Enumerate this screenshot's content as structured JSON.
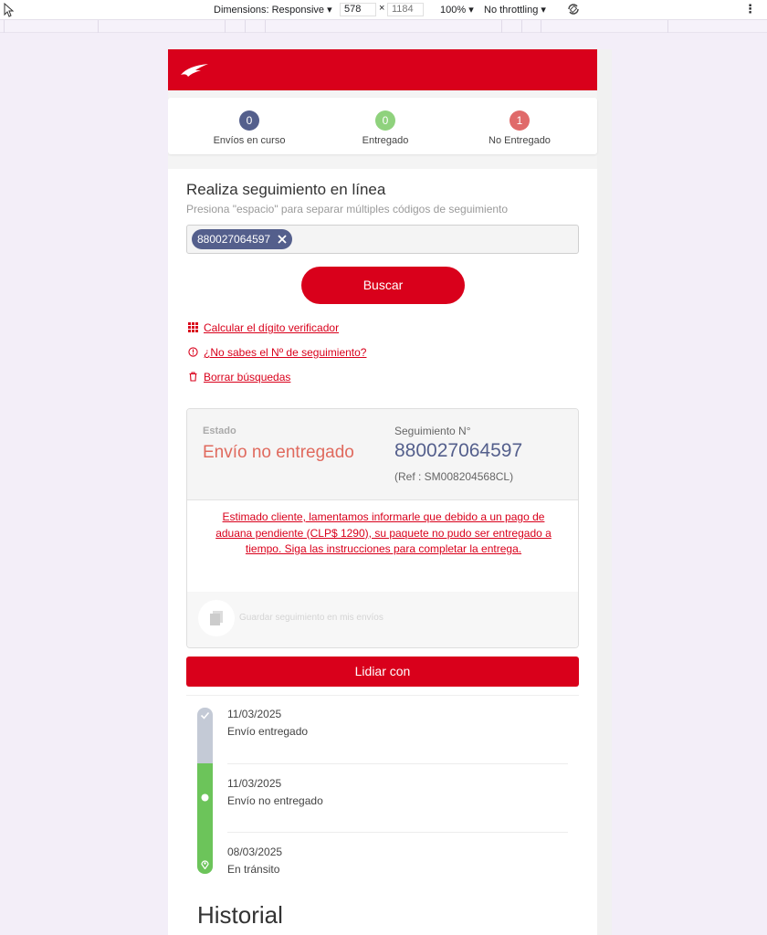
{
  "devtools": {
    "dimensions_label": "Dimensions: Responsive ▾",
    "width": "578",
    "times": "×",
    "height": "1184",
    "zoom": "100% ▾",
    "throttling": "No throttling ▾",
    "kebab": "⋮"
  },
  "counters": [
    {
      "count": "0",
      "label": "Envíos en curso",
      "color": "#545f8c"
    },
    {
      "count": "0",
      "label": "Entregado",
      "color": "#8fd27d"
    },
    {
      "count": "1",
      "label": "No Entregado",
      "color": "#e06a6a"
    }
  ],
  "search": {
    "title": "Realiza seguimiento en línea",
    "subtitle": "Presiona \"espacio\" para separar múltiples códigos de seguimiento",
    "chip": "880027064597",
    "button": "Buscar"
  },
  "links": {
    "calc": "Calcular el dígito verificador",
    "unknown": "¿No sabes el Nº de seguimiento?",
    "clear": "Borrar búsquedas"
  },
  "result": {
    "estado_label": "Estado",
    "estado_value": "Envío no entregado",
    "seg_label": "Seguimiento N°",
    "seg_value": "880027064597",
    "seg_ref": "(Ref : SM008204568CL)",
    "message": "Estimado cliente, lamentamos informarle que debido a un pago de aduana pendiente (CLP$ 1290), su paquete no pudo ser entregado a tiempo. Siga las instrucciones para completar la entrega.",
    "save_label": "Guardar seguimiento en mis envíos"
  },
  "action_button": "Lidiar con",
  "timeline": [
    {
      "date": "11/03/2025",
      "status": "Envío entregado",
      "icon": "check-icon"
    },
    {
      "date": "11/03/2025",
      "status": "Envío no entregado",
      "icon": "dot-icon"
    },
    {
      "date": "08/03/2025",
      "status": "En tránsito",
      "icon": "location-pin-icon"
    }
  ],
  "historial_title": "Historial",
  "colors": {
    "brand_red": "#d9001b",
    "navy": "#545f8c",
    "green": "#6cc45a",
    "status_red": "#e06a5e"
  }
}
